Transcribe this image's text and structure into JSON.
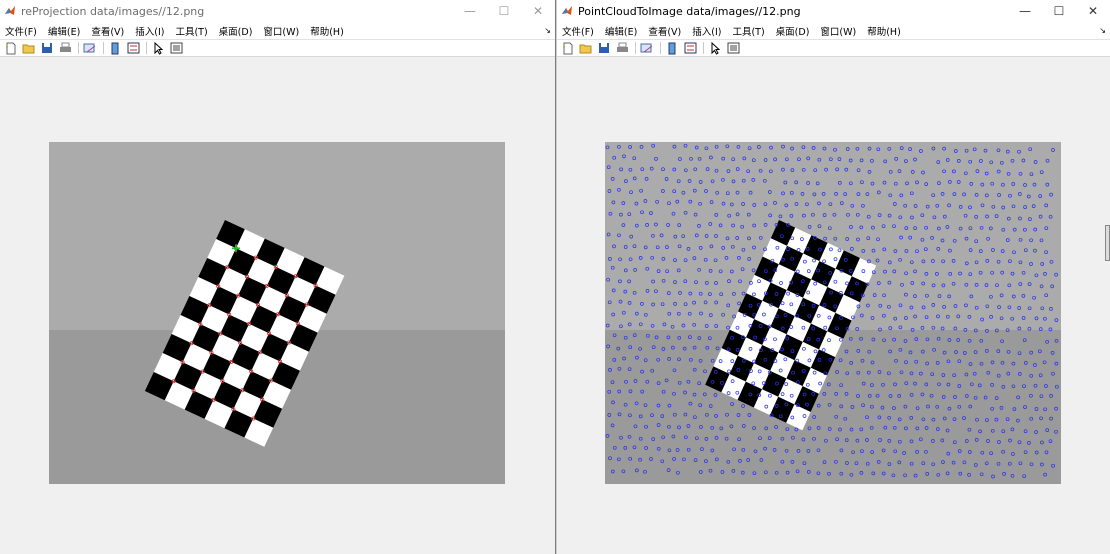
{
  "windows": [
    {
      "id": "left",
      "title": "reProjection data/images//12.png",
      "menu": [
        "文件(F)",
        "编辑(E)",
        "查看(V)",
        "插入(I)",
        "工具(T)",
        "桌面(D)",
        "窗口(W)",
        "帮助(H)"
      ],
      "controls": {
        "minimize": "—",
        "maximize": "☐",
        "close": "✕"
      },
      "toolbar_icons": [
        "new-figure-icon",
        "open-file-icon",
        "save-icon",
        "print-icon",
        "link-plot-icon",
        "colorbar-icon",
        "legend-icon",
        "pointer-icon",
        "property-inspector-icon"
      ],
      "image": {
        "grid_cols": 6,
        "grid_rows": 9,
        "detected_corner_marker": "green-plus",
        "reprojected_marker": "red-circle"
      }
    },
    {
      "id": "right",
      "title": "PointCloudToImage data/images//12.png",
      "menu": [
        "文件(F)",
        "编辑(E)",
        "查看(V)",
        "插入(I)",
        "工具(T)",
        "桌面(D)",
        "窗口(W)",
        "帮助(H)"
      ],
      "controls": {
        "minimize": "—",
        "maximize": "☐",
        "close": "✕"
      },
      "toolbar_icons": [
        "new-figure-icon",
        "open-file-icon",
        "save-icon",
        "print-icon",
        "link-plot-icon",
        "colorbar-icon",
        "legend-icon",
        "pointer-icon",
        "property-inspector-icon"
      ],
      "image": {
        "grid_cols": 6,
        "grid_rows": 9,
        "point_marker": "blue-circle"
      }
    }
  ],
  "colors": {
    "matlab_orange": "#d9541a",
    "wall_gray": "#ababab",
    "floor_gray": "#9a9a9a",
    "point_blue": "#2a32e6",
    "corner_red": "#e03030",
    "corner_green": "#20c020"
  }
}
